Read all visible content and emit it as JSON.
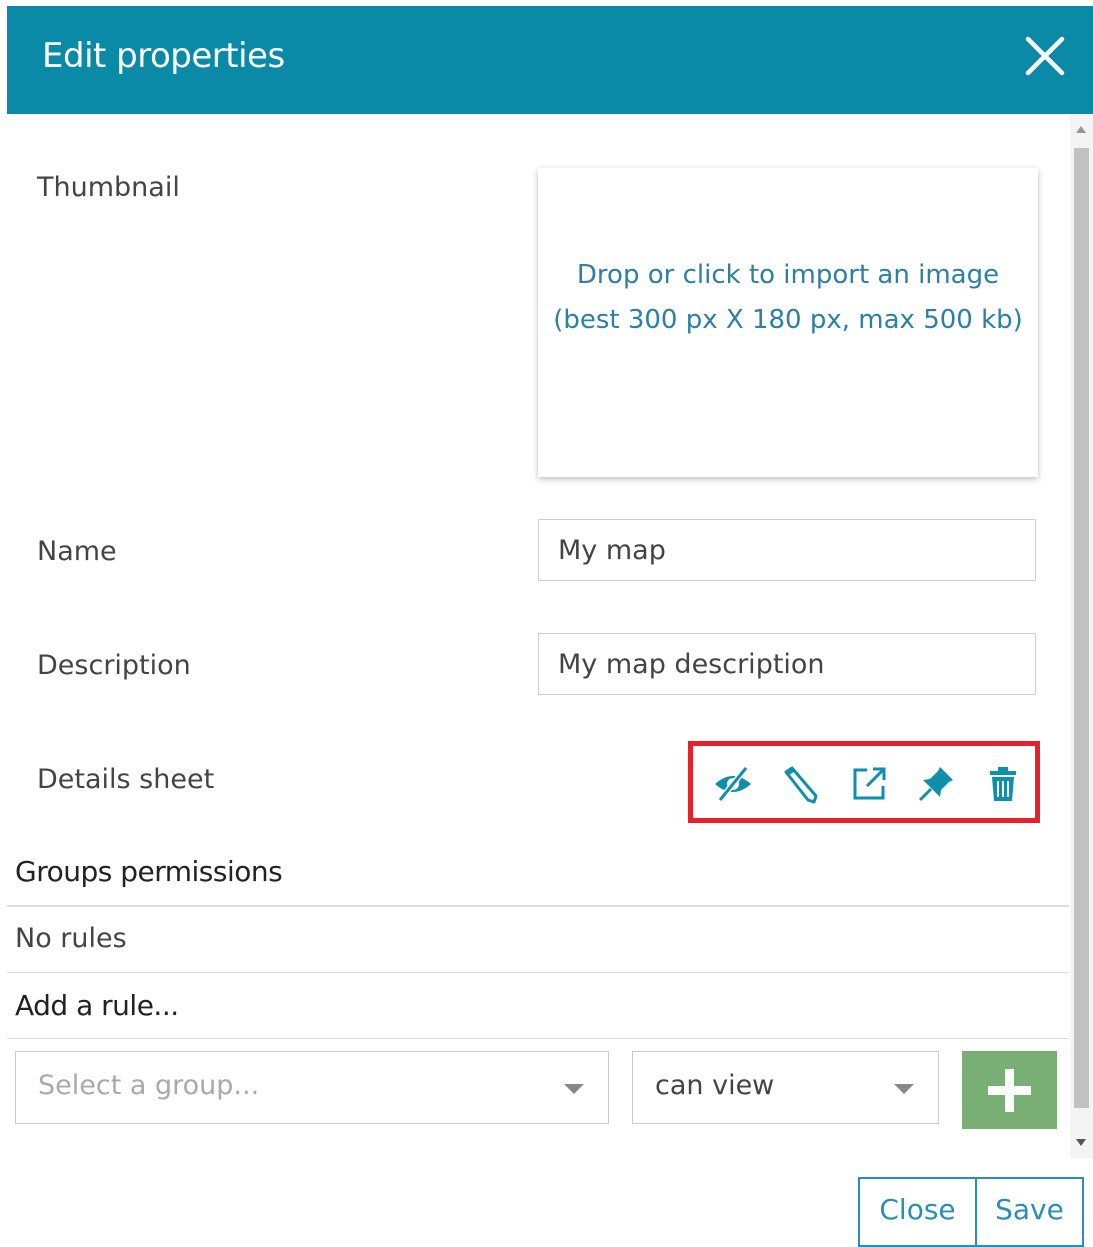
{
  "dialog": {
    "title": "Edit properties",
    "close_icon": "close-icon"
  },
  "form": {
    "thumbnail_label": "Thumbnail",
    "thumbnail_drop_line1": "Drop or click to import an image",
    "thumbnail_drop_line2": "(best 300 px X 180 px, max 500 kb)",
    "name_label": "Name",
    "name_value": "My map",
    "description_label": "Description",
    "description_value": "My map description",
    "details_sheet_label": "Details sheet",
    "details_sheet_icons": [
      "eye-slash-icon",
      "pencil-icon",
      "external-link-icon",
      "pin-icon",
      "trash-icon"
    ]
  },
  "permissions": {
    "title": "Groups permissions",
    "no_rules": "No rules",
    "add_rule_title": "Add a rule...",
    "group_placeholder": "Select a group...",
    "permission_value": "can view",
    "add_icon": "plus-icon"
  },
  "footer": {
    "close_label": "Close",
    "save_label": "Save"
  },
  "colors": {
    "header": "#0a8aa6",
    "icons": "#0e8fab",
    "highlight": "#e8202a",
    "add_button": "#79ae74",
    "footer_buttons": "#2a8fb4"
  }
}
